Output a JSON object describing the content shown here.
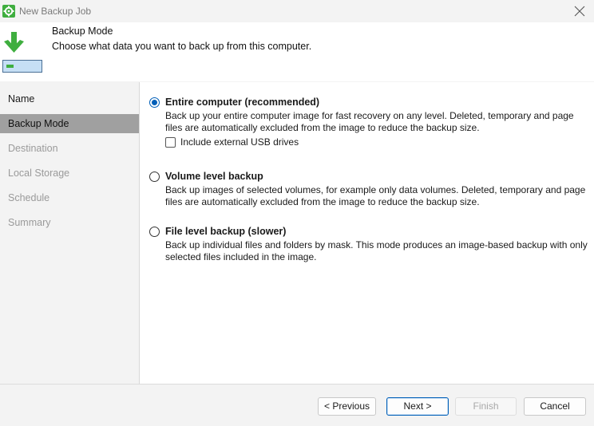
{
  "window": {
    "title": "New Backup Job",
    "close_icon": "close-icon",
    "app_icon": "veeam-gear-icon"
  },
  "header": {
    "title": "Backup Mode",
    "description": "Choose what data you want to back up from this computer.",
    "icon": "download-arrow-drive-icon",
    "accent": "#3fae3f"
  },
  "sidebar": {
    "items": [
      {
        "label": "Name",
        "state": "done"
      },
      {
        "label": "Backup Mode",
        "state": "active"
      },
      {
        "label": "Destination",
        "state": "future"
      },
      {
        "label": "Local Storage",
        "state": "future"
      },
      {
        "label": "Schedule",
        "state": "future"
      },
      {
        "label": "Summary",
        "state": "future"
      }
    ]
  },
  "options": [
    {
      "label": "Entire computer (recommended)",
      "description": "Back up your entire computer image for fast recovery on any level. Deleted, temporary and page files are automatically excluded from the image to reduce the backup size.",
      "selected": true,
      "checkbox": {
        "label": "Include external USB drives",
        "checked": false
      }
    },
    {
      "label": "Volume level backup",
      "description": "Back up images of selected volumes, for example only data volumes. Deleted, temporary and page files are automatically excluded from the image to reduce the backup size.",
      "selected": false
    },
    {
      "label": "File level backup (slower)",
      "description": "Back up individual files and folders by mask. This mode produces an image-based backup with only selected files included in the image.",
      "selected": false
    }
  ],
  "buttons": {
    "previous": "< Previous",
    "next": "Next >",
    "finish": "Finish",
    "cancel": "Cancel"
  },
  "colors": {
    "accent_blue": "#005fb8",
    "active_nav": "#a0a0a0",
    "disabled_text": "#a8a8a8"
  }
}
